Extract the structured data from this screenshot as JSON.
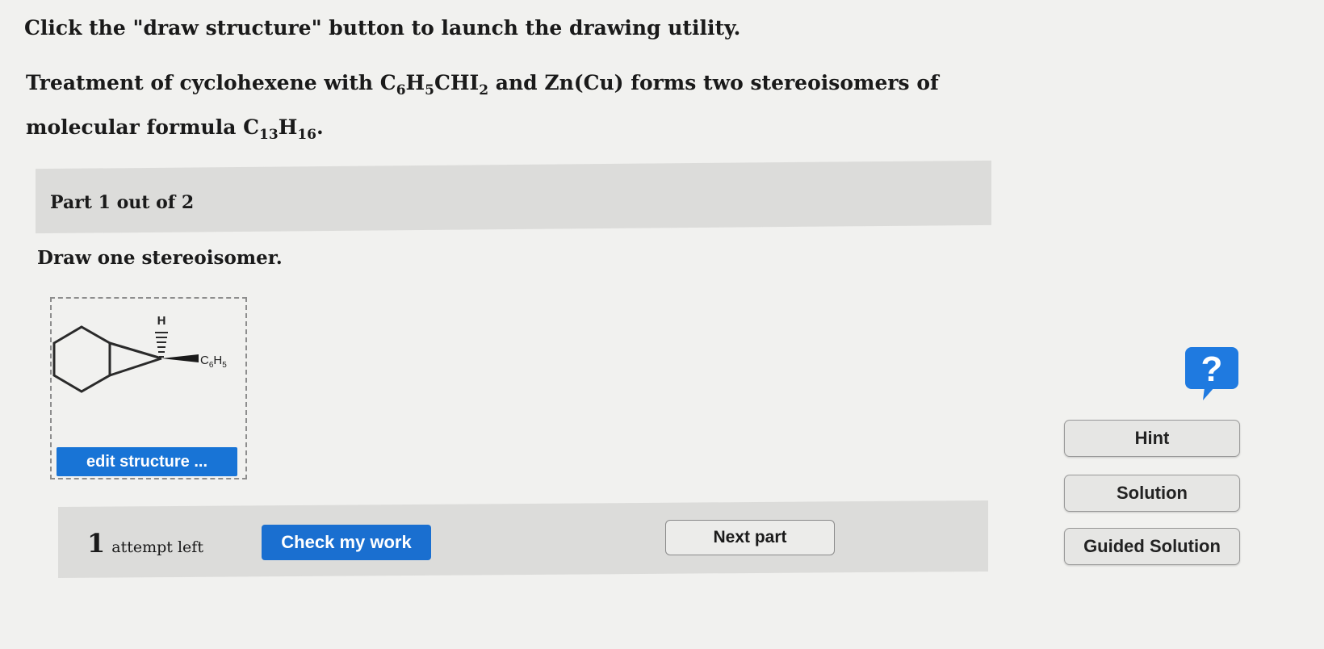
{
  "intro": "Click the \"draw structure\" button to launch the drawing utility.",
  "question": {
    "part1": "Treatment of cyclohexene with C",
    "sub1": "6",
    "part2": "H",
    "sub2": "5",
    "part3": "CHI",
    "sub3": "2",
    "part4": " and Zn(Cu) forms two stereoisomers of molecular formula C",
    "sub4": "13",
    "part5": "H",
    "sub5": "16",
    "part6": "."
  },
  "part_label": "Part 1 out of 2",
  "draw_prompt": "Draw one stereoisomer.",
  "structure": {
    "h_label": "H",
    "substituent_main": "C",
    "substituent_sub1": "6",
    "substituent_mid": "H",
    "substituent_sub2": "5",
    "edit_button": "edit structure ..."
  },
  "attempts": {
    "count": "1",
    "label": "attempt left"
  },
  "buttons": {
    "check": "Check my work",
    "next": "Next part",
    "hint": "Hint",
    "solution": "Solution",
    "guided": "Guided Solution",
    "help": "?"
  },
  "colors": {
    "primary_blue": "#1a6fd0",
    "help_blue": "#1f7ae0"
  }
}
